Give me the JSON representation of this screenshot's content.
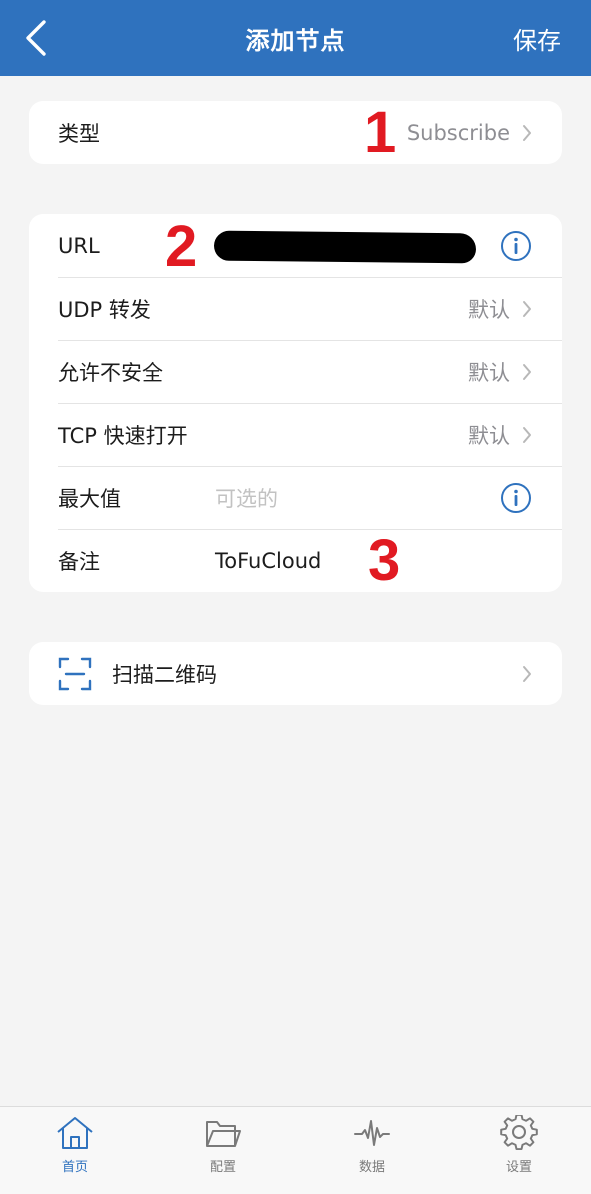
{
  "nav": {
    "title": "添加节点",
    "save_label": "保存",
    "background": "#2f72be"
  },
  "type_row": {
    "label": "类型",
    "value": "Subscribe"
  },
  "rows": [
    {
      "label": "URL",
      "value": "",
      "accessory": "info-icon"
    },
    {
      "label": "UDP 转发",
      "value": "默认",
      "accessory": "chevron-right-icon"
    },
    {
      "label": "允许不安全",
      "value": "默认",
      "accessory": "chevron-right-icon"
    },
    {
      "label": "TCP 快速打开",
      "value": "默认",
      "accessory": "chevron-right-icon"
    },
    {
      "label": "最大值",
      "placeholder": "可选的",
      "accessory": "info-icon"
    },
    {
      "label": "备注",
      "value": "ToFuCloud"
    }
  ],
  "scan": {
    "label": "扫描二维码",
    "icon": "qr-scan-icon"
  },
  "markers": [
    "1",
    "2",
    "3"
  ],
  "tabs": [
    {
      "label": "首页",
      "icon": "home-icon",
      "active": true
    },
    {
      "label": "配置",
      "icon": "folder-icon",
      "active": false
    },
    {
      "label": "数据",
      "icon": "activity-icon",
      "active": false
    },
    {
      "label": "设置",
      "icon": "gear-icon",
      "active": false
    }
  ],
  "colors": {
    "accent": "#2f72be",
    "marker": "#e11a22",
    "background": "#f4f4f4"
  }
}
